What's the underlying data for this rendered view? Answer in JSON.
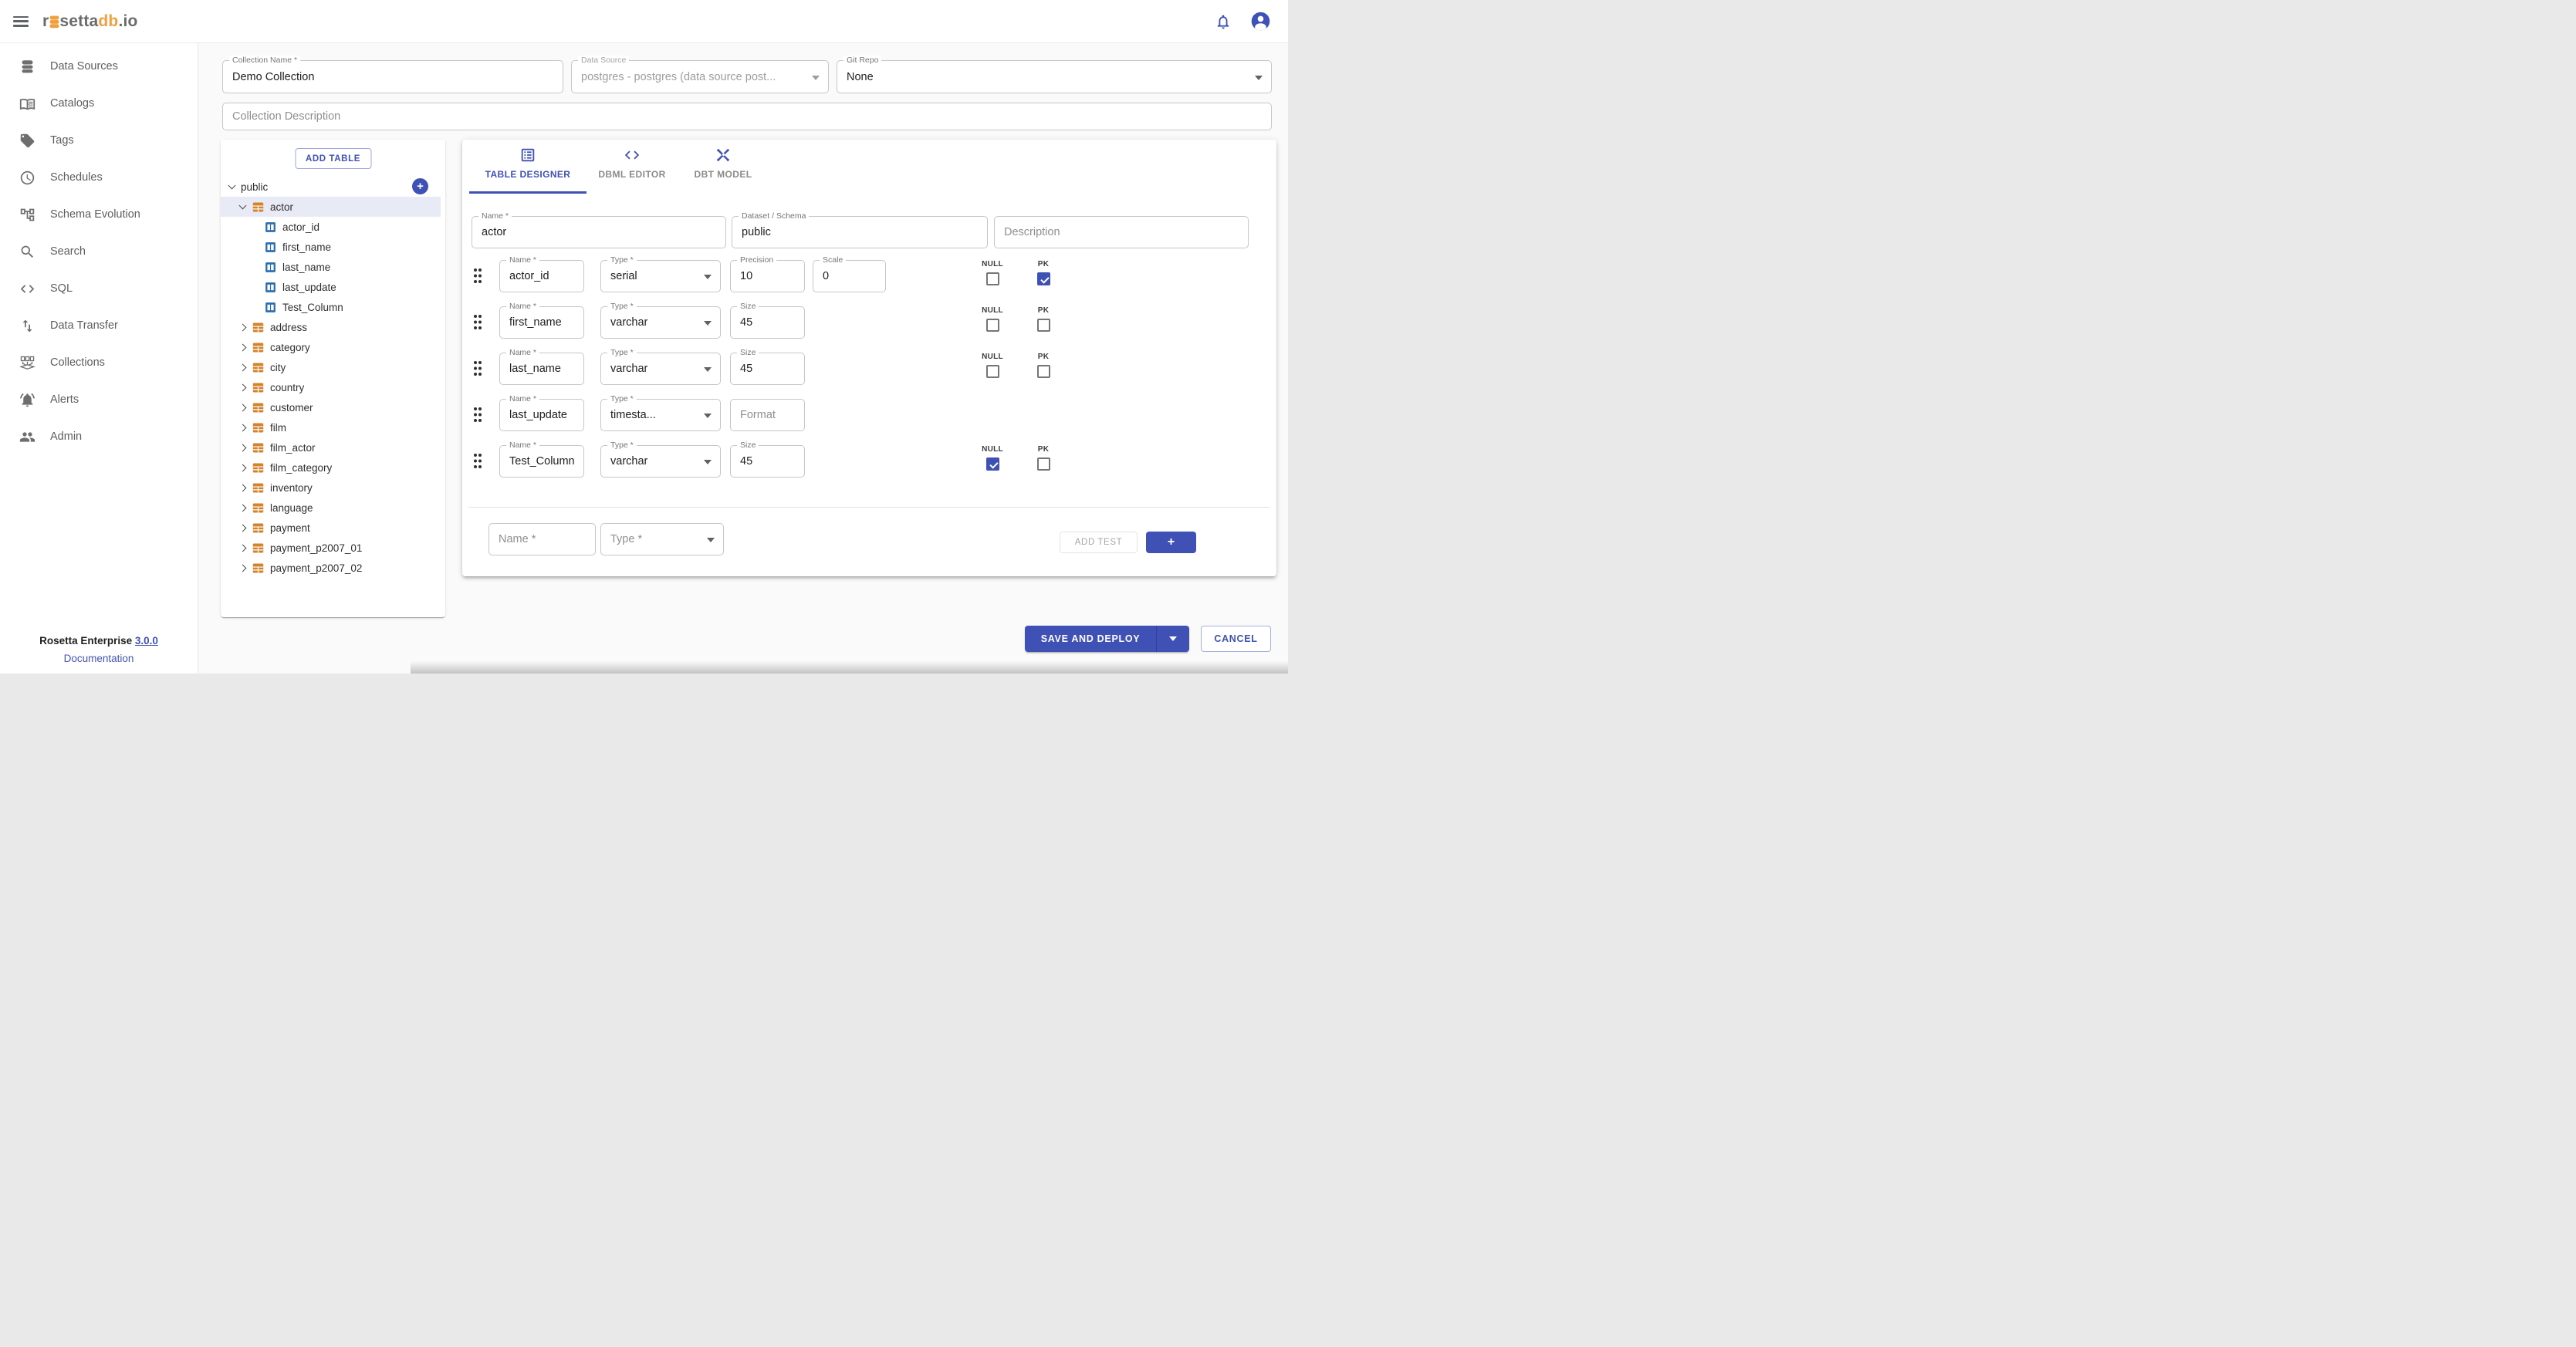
{
  "topbar": {
    "logo": {
      "part1": "r",
      "part2": "setta",
      "part3": "db",
      "part4": ".io"
    }
  },
  "sidebar": {
    "items": [
      {
        "icon": "database-icon",
        "label": "Data Sources"
      },
      {
        "icon": "book-icon",
        "label": "Catalogs"
      },
      {
        "icon": "tag-icon",
        "label": "Tags"
      },
      {
        "icon": "clock-icon",
        "label": "Schedules"
      },
      {
        "icon": "schema-tree-icon",
        "label": "Schema Evolution"
      },
      {
        "icon": "search-icon",
        "label": "Search"
      },
      {
        "icon": "code-icon",
        "label": "SQL"
      },
      {
        "icon": "transfer-arrows-icon",
        "label": "Data Transfer"
      },
      {
        "icon": "collections-icon",
        "label": "Collections"
      },
      {
        "icon": "alert-bell-icon",
        "label": "Alerts"
      },
      {
        "icon": "people-icon",
        "label": "Admin"
      }
    ],
    "footer": {
      "product": "Rosetta Enterprise",
      "version": "3.0.0",
      "doc_link": "Documentation"
    }
  },
  "collection_form": {
    "collection_name": {
      "label": "Collection Name *",
      "value": "Demo Collection"
    },
    "data_source": {
      "label": "Data Source",
      "value": "postgres - postgres (data source post...",
      "disabled": true
    },
    "git_repo": {
      "label": "Git Repo",
      "value": "None"
    },
    "description_placeholder": "Collection Description"
  },
  "tree_panel": {
    "add_table_label": "ADD TABLE",
    "schema": {
      "name": "public"
    },
    "selected_table": "actor",
    "actor_columns": [
      "actor_id",
      "first_name",
      "last_name",
      "last_update",
      "Test_Column"
    ],
    "collapsed_tables": [
      "address",
      "category",
      "city",
      "country",
      "customer",
      "film",
      "film_actor",
      "film_category",
      "inventory",
      "language",
      "payment",
      "payment_p2007_01",
      "payment_p2007_02"
    ]
  },
  "designer": {
    "tabs": [
      {
        "label": "TABLE DESIGNER",
        "icon": "table-designer-icon",
        "active": true
      },
      {
        "label": "DBML EDITOR",
        "icon": "code-icon",
        "active": false
      },
      {
        "label": "DBT MODEL",
        "icon": "dbt-star-icon",
        "active": false
      }
    ],
    "table_fields": {
      "name": {
        "label": "Name *",
        "value": "actor"
      },
      "schema": {
        "label": "Dataset / Schema",
        "value": "public"
      },
      "description_placeholder": "Description"
    },
    "field_labels": {
      "name": "Name *",
      "type": "Type *",
      "null": "NULL",
      "pk": "PK"
    },
    "columns": [
      {
        "name": "actor_id",
        "type": "serial",
        "extras": [
          {
            "label": "Precision",
            "value": "10"
          },
          {
            "label": "Scale",
            "value": "0"
          }
        ],
        "flags": {
          "null": false,
          "pk": true
        }
      },
      {
        "name": "first_name",
        "type": "varchar",
        "extras": [
          {
            "label": "Size",
            "value": "45"
          }
        ],
        "flags": {
          "null": false,
          "pk": false
        }
      },
      {
        "name": "last_name",
        "type": "varchar",
        "extras": [
          {
            "label": "Size",
            "value": "45"
          }
        ],
        "flags": {
          "null": false,
          "pk": false
        }
      },
      {
        "name": "last_update",
        "type": "timesta...",
        "extras": [
          {
            "placeholder": "Format"
          }
        ],
        "flags": null
      },
      {
        "name": "Test_Column",
        "type": "varchar",
        "extras": [
          {
            "label": "Size",
            "value": "45"
          }
        ],
        "flags": {
          "null": true,
          "pk": false
        }
      }
    ],
    "add_row": {
      "name_placeholder": "Name *",
      "type_placeholder": "Type *",
      "add_test_label": "ADD TEST",
      "plus_label": "+"
    }
  },
  "actions": {
    "save": "SAVE AND DEPLOY",
    "cancel": "CANCEL"
  },
  "colors": {
    "primary": "#3f51b5",
    "logo_orange": "#efa03f",
    "table_icon": "#d3832b",
    "column_icon": "#2a6db0",
    "selected_row_bg": "#e8eaf6"
  }
}
